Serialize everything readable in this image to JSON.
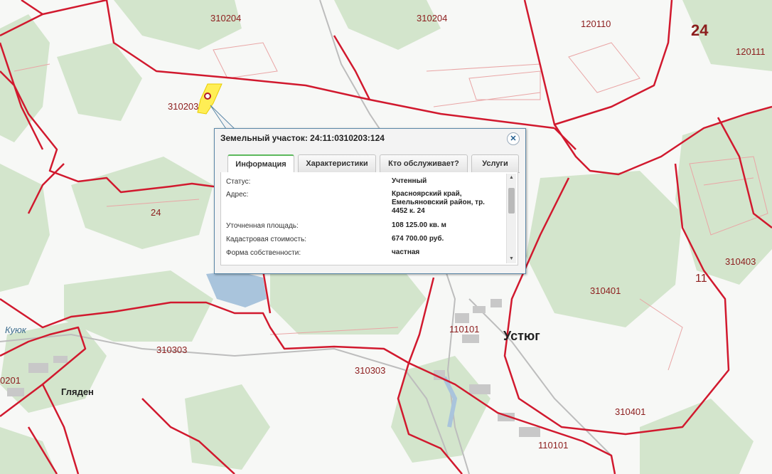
{
  "colors": {
    "boundary": "#d1192e",
    "forest": "#cfe2c9",
    "water": "#a9c4dc",
    "highlight": "#ffee55",
    "road": "#b5b5b5",
    "accent_tab": "#5cb85c"
  },
  "map": {
    "parcel_labels": [
      "310204",
      "310204",
      "120110",
      "24",
      "120111",
      "310203",
      "24",
      "310403",
      "11",
      "310401",
      "110101",
      "310303",
      "310303",
      "310401",
      "110101",
      "0201"
    ],
    "places": [
      "Устюг",
      "Гляден"
    ],
    "river": "Куюк"
  },
  "popup": {
    "title": "Земельный участок: 24:11:0310203:124",
    "close_icon": "close-icon",
    "tabs": [
      "Информация",
      "Характеристики",
      "Кто обслуживает?",
      "Услуги"
    ],
    "active_tab": "Информация",
    "fields": [
      {
        "label": "Статус:",
        "value": "Учтенный"
      },
      {
        "label": "Адрес:",
        "value": "Красноярский край, Емельяновский район, тр. 4452 к. 24"
      },
      {
        "label": "Уточненная площадь:",
        "value": "108 125.00 кв. м"
      },
      {
        "label": "Кадастровая стоимость:",
        "value": "674 700.00 руб."
      },
      {
        "label": "Форма собственности:",
        "value": "частная"
      }
    ]
  }
}
